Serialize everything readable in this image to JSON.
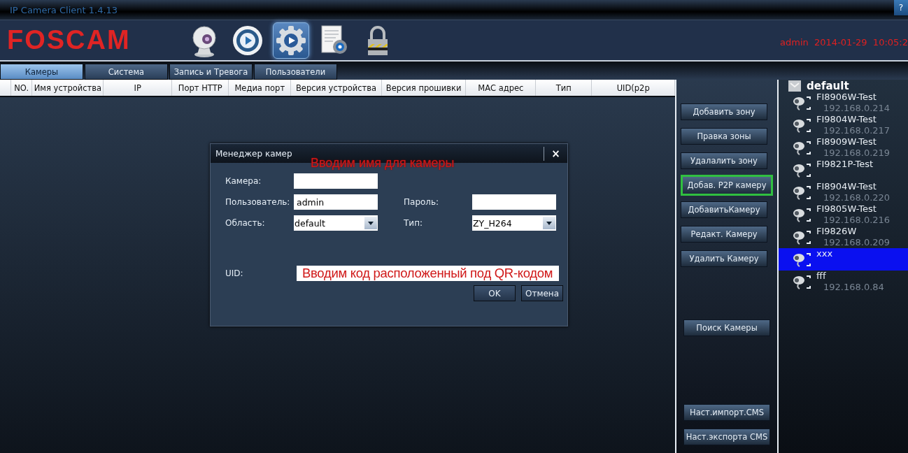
{
  "window": {
    "title": "IP Camera Client 1.4.13",
    "help": "?"
  },
  "header": {
    "logo": "FOSCAM",
    "toolbar": [
      {
        "kind": "webcam",
        "selected": false
      },
      {
        "kind": "play",
        "selected": false
      },
      {
        "kind": "gear",
        "selected": true
      },
      {
        "kind": "document",
        "selected": false
      },
      {
        "kind": "padlock",
        "selected": false
      }
    ],
    "status": "admin  2014-01-29  10:05:2"
  },
  "tabs": [
    {
      "label": "Камеры",
      "selected": true
    },
    {
      "label": "Система",
      "selected": false
    },
    {
      "label": "Запись и Тревога",
      "selected": false
    },
    {
      "label": "Пользователи",
      "selected": false
    }
  ],
  "table": {
    "columns": [
      "NO.",
      "Имя устройства",
      "IP",
      "Порт HTTP",
      "Медиа порт",
      "Версия устройства",
      "Версия прошивки",
      "MAC адрес",
      "Тип",
      "UID(p2p"
    ]
  },
  "dialog": {
    "title": "Менеджер камер",
    "close": "×",
    "annotation": "Вводим имя для камеры",
    "fields": [
      {
        "label": "Камера:",
        "kind": "text"
      },
      {
        "label": "Пользователь:",
        "kind": "text",
        "value": "admin"
      },
      {
        "label": "Пароль:",
        "kind": "text"
      },
      {
        "label": "Область:",
        "kind": "select",
        "value": "default"
      },
      {
        "label": "Тип:",
        "kind": "select",
        "value": "ZY_H264"
      }
    ],
    "uid": {
      "label": "UID:",
      "annotation": "Вводим код расположенный под QR-кодом"
    },
    "buttons": [
      "OK",
      "Отмена"
    ]
  },
  "button_groups": [
    [
      {
        "label": "Добавить зону",
        "highlighted": false
      },
      {
        "label": "Правка зоны",
        "highlighted": false
      },
      {
        "label": "Удалалить зону",
        "highlighted": false
      },
      {
        "label": "Добав. P2P камеру",
        "highlighted": true
      },
      {
        "label": "ДобавитьКамеру",
        "highlighted": false
      },
      {
        "label": "Редакт. Камеру",
        "highlighted": false
      },
      {
        "label": "Удалить Камеру",
        "highlighted": false
      }
    ],
    [
      {
        "label": "Поиск Камеры",
        "highlighted": false
      }
    ],
    [
      {
        "label": "Наст.импорт.CMS",
        "highlighted": false
      },
      {
        "label": "Наст.экспорта CMS",
        "highlighted": false
      }
    ]
  ],
  "tree": {
    "label": "default",
    "expanded": true,
    "children": [
      {
        "name": "FI8906W-Test",
        "ip": "192.168.0.214",
        "selected": false
      },
      {
        "name": "FI9804W-Test",
        "ip": "192.168.0.217",
        "selected": false
      },
      {
        "name": "FI8909W-Test",
        "ip": "192.168.0.219",
        "selected": false
      },
      {
        "name": "FI9821P-Test",
        "selected": false
      },
      {
        "name": "FI8904W-Test",
        "ip": "192.168.0.220",
        "selected": false
      },
      {
        "name": "FI9805W-Test",
        "ip": "192.168.0.216",
        "selected": false
      },
      {
        "name": "FI9826W",
        "ip": "192.168.0.209",
        "selected": false
      },
      {
        "name": "xxx",
        "selected": true
      },
      {
        "name": "fff",
        "ip": "192.168.0.84",
        "selected": false
      }
    ]
  }
}
